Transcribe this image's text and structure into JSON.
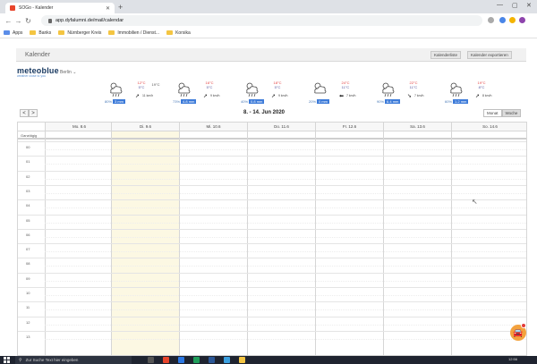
{
  "browser": {
    "tab_title": "SOGo - Kalender",
    "url": "app.dyfalumni.de/mail/calendar",
    "bookmarks": [
      "Apps",
      "Banks",
      "Nürnberger Kreis",
      "Immobilien / Dienst...",
      "Korsika"
    ]
  },
  "app": {
    "title": "Kalender",
    "btn_calendar_list": "Kalenderliste",
    "btn_calendar_settings": "Kalender exportieren"
  },
  "brand": {
    "logo": "meteoblue",
    "subtitle": "weather close to you",
    "location": "Berlin"
  },
  "weather": [
    {
      "tmax": "12°C",
      "tmin": "5°C",
      "tmin2": "19°C",
      "wind": "11 km/h",
      "rain_pct": "80%",
      "rain_mm": "3 mm",
      "arrow": "➚"
    },
    {
      "tmax": "16°C",
      "tmin": "5°C",
      "wind": "9 km/h",
      "rain_pct": "73%",
      "rain_mm": "4.8 mm",
      "arrow": "➚"
    },
    {
      "tmax": "18°C",
      "tmin": "5°C",
      "wind": "9 km/h",
      "rain_pct": "40%",
      "rain_mm": "0.8 mm",
      "arrow": "➚"
    },
    {
      "tmax": "24°C",
      "tmin": "11°C",
      "wind": "7 km/h",
      "rain_pct": "20%",
      "rain_mm": "0 mm",
      "arrow": "⬅"
    },
    {
      "tmax": "22°C",
      "tmin": "11°C",
      "wind": "7 km/h",
      "rain_pct": "90%",
      "rain_mm": "6.4 mm",
      "arrow": "➘"
    },
    {
      "tmax": "19°C",
      "tmin": "8°C",
      "wind": "8 km/h",
      "rain_pct": "60%",
      "rain_mm": "1.2 mm",
      "arrow": "➚"
    }
  ],
  "calendar": {
    "prev": "<",
    "next": ">",
    "range": "8. - 14. Jun 2020",
    "view_month": "Monat",
    "view_week": "Woche",
    "days": [
      "Mo. 8.6",
      "Di. 9.6",
      "Mi. 10.6",
      "Do. 11.6",
      "Fr. 12.6",
      "Sa. 13.6",
      "So. 14.6"
    ],
    "allday_label": "Ganztägig",
    "hours": [
      "00",
      "01",
      "02",
      "03",
      "04",
      "05",
      "06",
      "07",
      "08",
      "09",
      "10",
      "11",
      "12",
      "13"
    ]
  },
  "taskbar": {
    "search_placeholder": "Zur Suche Text hier eingeben",
    "clock": "12:56"
  },
  "colors": {
    "today_bg": "#fcf8e3",
    "rain_bar": "#3d7bd9",
    "temp_max": "#e54141",
    "fab": "#f3a23e"
  }
}
